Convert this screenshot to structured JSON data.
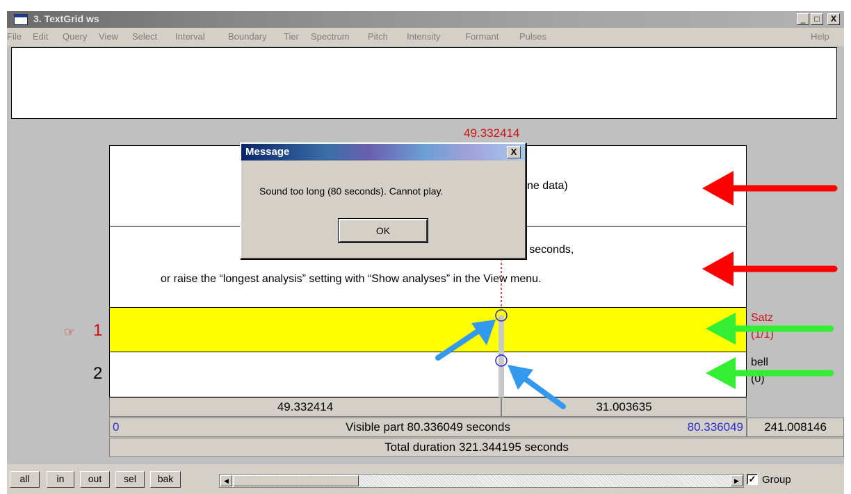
{
  "window": {
    "title": "3. TextGrid ws"
  },
  "title_buttons": [
    "_",
    "□",
    "X"
  ],
  "menu": [
    "File",
    "Edit",
    "Query",
    "View",
    "Select",
    "Interval",
    "Boundary",
    "Tier",
    "Spectrum",
    "Pitch",
    "Intensity",
    "Formant",
    "Pulses"
  ],
  "menu_help": "Help",
  "cursor_time": "49.332414",
  "panels": {
    "waveform_text": "ne data)",
    "spectrogram_line1": "10 seconds,",
    "spectrogram_line2": "or raise the “longest analysis” setting with “Show analyses” in the View menu."
  },
  "tiers": [
    {
      "marker": "☞",
      "number": "1",
      "name": "Satz",
      "count": "(1/1)",
      "color": "#ffff00"
    },
    {
      "marker": "",
      "number": "2",
      "name": "bell",
      "count": "(0)",
      "color": "#ffffff"
    }
  ],
  "selection": {
    "left": "49.332414",
    "right": "31.003635"
  },
  "visible": {
    "start": "0",
    "label": "Visible part 80.336049 seconds",
    "end": "80.336049",
    "after": "241.008146"
  },
  "total": {
    "label": "Total duration 321.344195 seconds"
  },
  "buttons": [
    "all",
    "in",
    "out",
    "sel",
    "bak"
  ],
  "group": {
    "label": "Group",
    "checked": true,
    "mark": "✓"
  },
  "dialog": {
    "title": "Message",
    "message": "Sound too long (80 seconds). Cannot play.",
    "ok": "OK",
    "close": "X"
  },
  "colors": {
    "annotation_red": "#ff0000",
    "annotation_green": "#33ee33",
    "annotation_blue": "#3399ee",
    "cursor": "#cc1111"
  },
  "icons": [
    "window-icon",
    "pointing-hand-icon",
    "close-icon",
    "minimize-icon",
    "maximize-icon",
    "scroll-left-icon",
    "scroll-right-icon",
    "checkbox-icon"
  ]
}
